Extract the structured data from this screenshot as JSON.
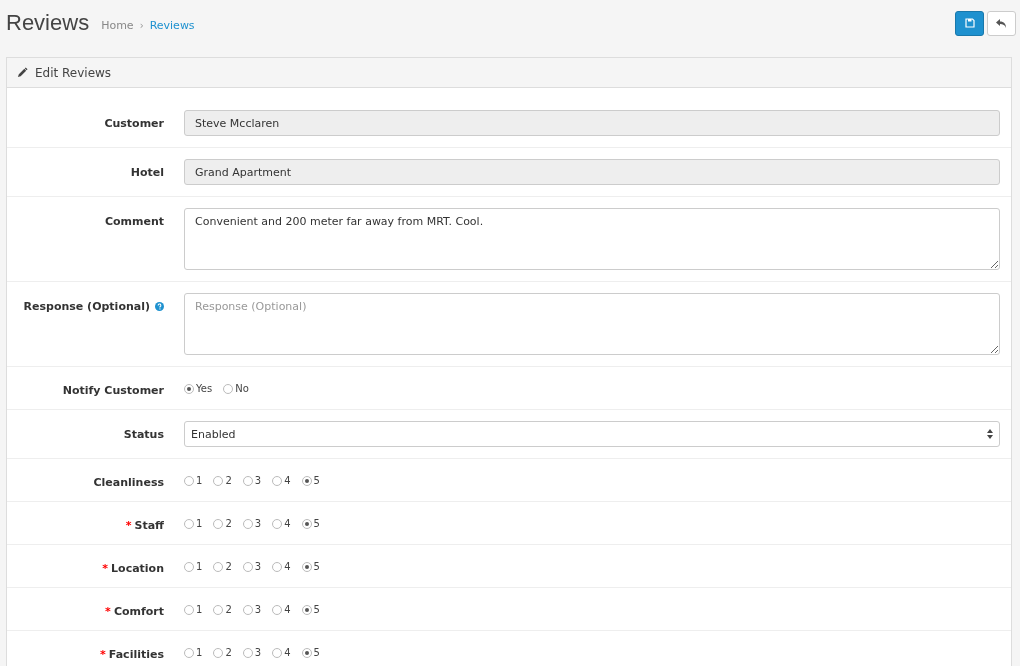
{
  "page": {
    "title": "Reviews",
    "breadcrumb": [
      {
        "label": "Home",
        "selected": false
      },
      {
        "separator": "›",
        "label": "Reviews",
        "selected": true
      }
    ]
  },
  "toolbar": {
    "buttons": [
      {
        "kind": "save"
      },
      {
        "kind": "back"
      }
    ]
  },
  "panel": {
    "title": "Edit Reviews"
  },
  "rows": [
    {
      "kind": "text",
      "label": "Customer",
      "value": "Steve Mcclaren",
      "disabled": true
    },
    {
      "kind": "text",
      "label": "Hotel",
      "value": "Grand Apartment",
      "disabled": true
    },
    {
      "kind": "textarea",
      "label": "Comment",
      "value": "Convenient and 200 meter far away from MRT. Cool."
    },
    {
      "kind": "textarea",
      "label": "Response (Optional)",
      "placeholder": "Response (Optional)",
      "help": true
    },
    {
      "kind": "radio",
      "label": "Notify Customer",
      "options": [
        {
          "label": "Yes",
          "selected": true
        },
        {
          "label": "No",
          "selected": false
        }
      ]
    },
    {
      "kind": "select",
      "label": "Status",
      "value": "Enabled"
    },
    {
      "kind": "radio",
      "label": "Cleanliness",
      "options": [
        {
          "label": "1",
          "selected": false
        },
        {
          "label": "2",
          "selected": false
        },
        {
          "label": "3",
          "selected": false
        },
        {
          "label": "4",
          "selected": false
        },
        {
          "label": "5",
          "selected": true
        }
      ]
    },
    {
      "kind": "radio",
      "label": "Staff",
      "required_mark": "*",
      "options": [
        {
          "label": "1",
          "selected": false
        },
        {
          "label": "2",
          "selected": false
        },
        {
          "label": "3",
          "selected": false
        },
        {
          "label": "4",
          "selected": false
        },
        {
          "label": "5",
          "selected": true
        }
      ]
    },
    {
      "kind": "radio",
      "label": "Location",
      "required_mark": "*",
      "options": [
        {
          "label": "1",
          "selected": false
        },
        {
          "label": "2",
          "selected": false
        },
        {
          "label": "3",
          "selected": false
        },
        {
          "label": "4",
          "selected": false
        },
        {
          "label": "5",
          "selected": true
        }
      ]
    },
    {
      "kind": "radio",
      "label": "Comfort",
      "required_mark": "*",
      "options": [
        {
          "label": "1",
          "selected": false
        },
        {
          "label": "2",
          "selected": false
        },
        {
          "label": "3",
          "selected": false
        },
        {
          "label": "4",
          "selected": false
        },
        {
          "label": "5",
          "selected": true
        }
      ]
    },
    {
      "kind": "radio",
      "label": "Facilities",
      "required_mark": "*",
      "options": [
        {
          "label": "1",
          "selected": false
        },
        {
          "label": "2",
          "selected": false
        },
        {
          "label": "3",
          "selected": false
        },
        {
          "label": "4",
          "selected": false
        },
        {
          "label": "5",
          "selected": true
        }
      ]
    }
  ]
}
